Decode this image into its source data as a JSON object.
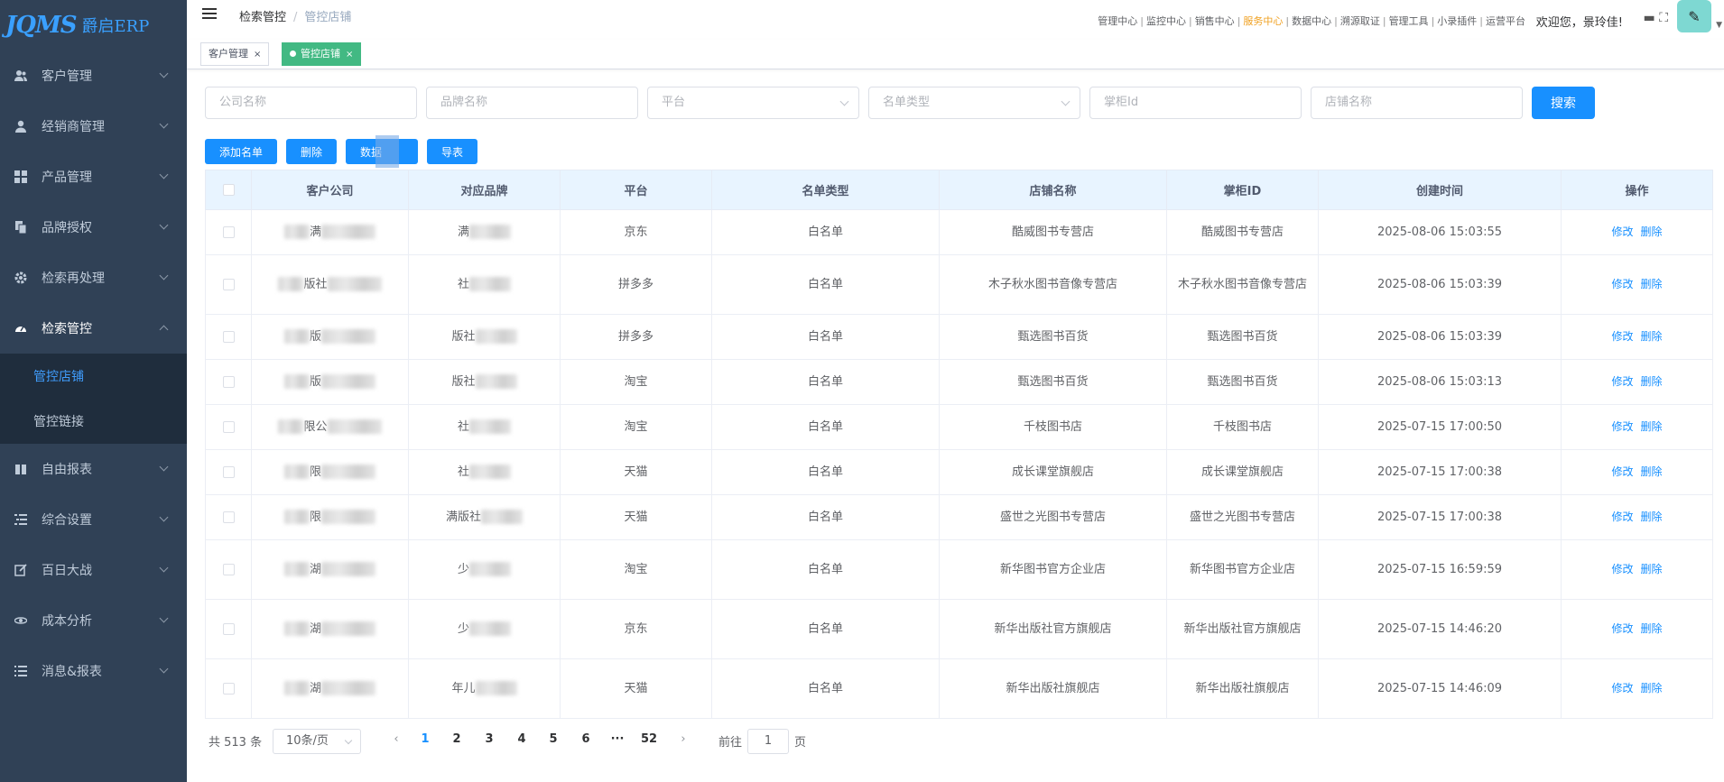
{
  "brand": {
    "logo_mark": "JQMS",
    "logo_sub": "爵启ERP"
  },
  "sidebar": {
    "items": [
      {
        "label": "客户管理",
        "icon": "users-icon"
      },
      {
        "label": "经销商管理",
        "icon": "user-icon"
      },
      {
        "label": "产品管理",
        "icon": "grid-icon"
      },
      {
        "label": "品牌授权",
        "icon": "document-copy-icon"
      },
      {
        "label": "检索再处理",
        "icon": "gear-icon"
      },
      {
        "label": "检索管控",
        "icon": "dashboard-icon"
      },
      {
        "label": "自由报表",
        "icon": "book-icon"
      },
      {
        "label": "综合设置",
        "icon": "list-indent-icon"
      },
      {
        "label": "百日大战",
        "icon": "edit-icon"
      },
      {
        "label": "成本分析",
        "icon": "eye-icon"
      },
      {
        "label": "消息&报表",
        "icon": "list-icon"
      }
    ],
    "submenu": [
      {
        "label": "管控店铺"
      },
      {
        "label": "管控链接"
      }
    ]
  },
  "header": {
    "breadcrumb": [
      "检索管控",
      "管控店铺"
    ],
    "topnav": [
      "管理中心",
      "监控中心",
      "销售中心",
      "服务中心",
      "数据中心",
      "溯源取证",
      "管理工具",
      "小录插件",
      "运营平台"
    ],
    "welcome": "欢迎您，景玲佳!"
  },
  "tags": [
    {
      "label": "客户管理"
    },
    {
      "label": "管控店铺"
    }
  ],
  "filters": {
    "company_placeholder": "公司名称",
    "brand_placeholder": "品牌名称",
    "platform_placeholder": "平台",
    "list_type_placeholder": "名单类型",
    "shopkeeper_placeholder": "掌柜Id",
    "shop_placeholder": "店铺名称",
    "search_label": "搜索"
  },
  "actions": {
    "add": "添加名单",
    "delete": "删除",
    "data": "数据",
    "export": "导表"
  },
  "table": {
    "headers": [
      "客户公司",
      "对应品牌",
      "平台",
      "名单类型",
      "店铺名称",
      "掌柜ID",
      "创建时间",
      "操作"
    ],
    "edit_label": "修改",
    "delete_label": "删除",
    "rows": [
      {
        "company": "满",
        "brand": "满",
        "platform": "京东",
        "type": "白名单",
        "shop": "酷威图书专营店",
        "keeper": "酷威图书专营店",
        "time": "2025-08-06 15:03:55"
      },
      {
        "company": "版社",
        "brand": "社",
        "platform": "拼多多",
        "type": "白名单",
        "shop": "木子秋水图书音像专营店",
        "keeper": "木子秋水图书音像专营店",
        "time": "2025-08-06 15:03:39"
      },
      {
        "company": "版",
        "brand": "版社",
        "platform": "拼多多",
        "type": "白名单",
        "shop": "甄选图书百货",
        "keeper": "甄选图书百货",
        "time": "2025-08-06 15:03:39"
      },
      {
        "company": "版",
        "brand": "版社",
        "platform": "淘宝",
        "type": "白名单",
        "shop": "甄选图书百货",
        "keeper": "甄选图书百货",
        "time": "2025-08-06 15:03:13"
      },
      {
        "company": "限公",
        "brand": "社",
        "platform": "淘宝",
        "type": "白名单",
        "shop": "千枝图书店",
        "keeper": "千枝图书店",
        "time": "2025-07-15 17:00:50"
      },
      {
        "company": "限",
        "brand": "社",
        "platform": "天猫",
        "type": "白名单",
        "shop": "成长课堂旗舰店",
        "keeper": "成长课堂旗舰店",
        "time": "2025-07-15 17:00:38"
      },
      {
        "company": "限",
        "brand": "满版社",
        "platform": "天猫",
        "type": "白名单",
        "shop": "盛世之光图书专营店",
        "keeper": "盛世之光图书专营店",
        "time": "2025-07-15 17:00:38"
      },
      {
        "company": "湖",
        "brand": "少",
        "platform": "淘宝",
        "type": "白名单",
        "shop": "新华图书官方企业店",
        "keeper": "新华图书官方企业店",
        "time": "2025-07-15 16:59:59"
      },
      {
        "company": "湖",
        "brand": "少",
        "platform": "京东",
        "type": "白名单",
        "shop": "新华出版社官方旗舰店",
        "keeper": "新华出版社官方旗舰店",
        "time": "2025-07-15 14:46:20"
      },
      {
        "company": "湖",
        "brand": "年儿",
        "platform": "天猫",
        "type": "白名单",
        "shop": "新华出版社旗舰店",
        "keeper": "新华出版社旗舰店",
        "time": "2025-07-15 14:46:09"
      }
    ]
  },
  "pagination": {
    "total": "共 513 条",
    "page_size": "10条/页",
    "pages": [
      "1",
      "2",
      "3",
      "4",
      "5",
      "6",
      "···",
      "52"
    ],
    "current": "1",
    "goto_prefix": "前往",
    "goto_value": "1",
    "goto_suffix": "页"
  }
}
